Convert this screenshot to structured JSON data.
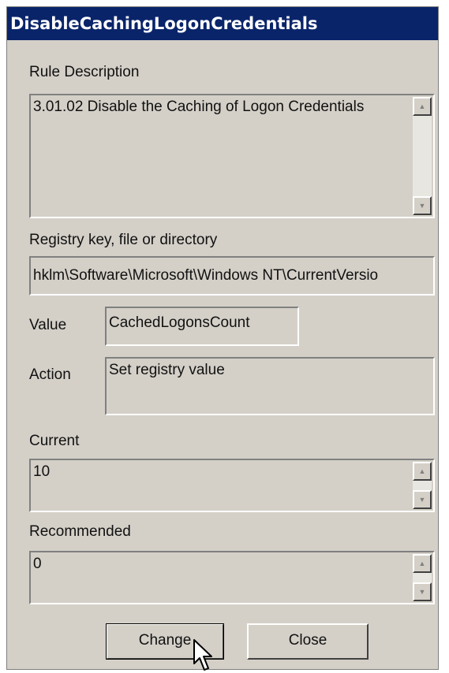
{
  "window": {
    "title": "DisableCachingLogonCredentials"
  },
  "rule_description": {
    "label": "Rule Description",
    "value": "3.01.02 Disable the Caching of Logon Credentials"
  },
  "registry": {
    "label": "Registry key, file or directory",
    "value": "hklm\\Software\\Microsoft\\Windows NT\\CurrentVersio"
  },
  "value_field": {
    "label": "Value",
    "value": "CachedLogonsCount"
  },
  "action_field": {
    "label": "Action",
    "value": "Set registry value"
  },
  "current": {
    "label": "Current",
    "value": "10"
  },
  "recommended": {
    "label": "Recommended",
    "value": "0"
  },
  "buttons": {
    "change": "Change",
    "close": "Close"
  },
  "icons": {
    "scroll_up": "scroll-up-arrow-icon",
    "scroll_down": "scroll-down-arrow-icon",
    "cursor": "mouse-pointer-icon"
  }
}
